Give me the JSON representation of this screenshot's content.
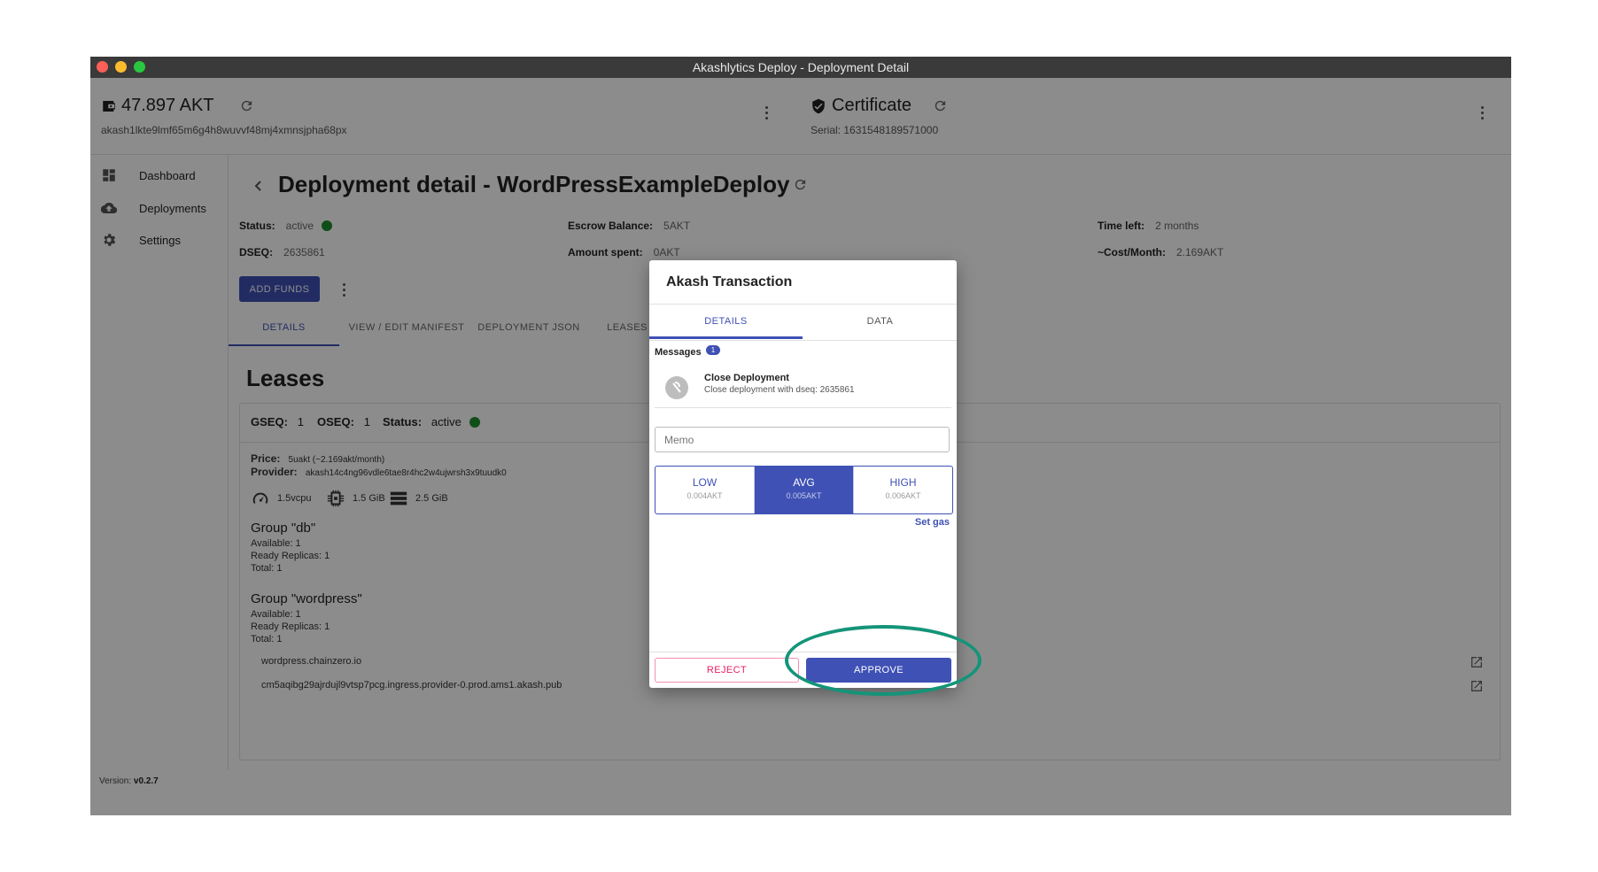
{
  "window": {
    "title": "Akashlytics Deploy - Deployment Detail"
  },
  "wallet": {
    "balance": "47.897 AKT",
    "address": "akash1lkte9lmf65m6g4h8wuvvf48mj4xmnsjpha68px"
  },
  "certificate": {
    "label": "Certificate",
    "serial": "Serial: 1631548189571000"
  },
  "sidebar": {
    "items": [
      {
        "label": "Dashboard"
      },
      {
        "label": "Deployments"
      },
      {
        "label": "Settings"
      }
    ]
  },
  "version": {
    "label": "Version:",
    "value": "v0.2.7"
  },
  "deployment": {
    "title": "Deployment detail - WordPressExampleDeploy",
    "status_label": "Status:",
    "status_value": "active",
    "dseq_label": "DSEQ:",
    "dseq_value": "2635861",
    "escrow_label": "Escrow Balance:",
    "escrow_value": "5AKT",
    "spent_label": "Amount spent:",
    "spent_value": "0AKT",
    "time_label": "Time left:",
    "time_value": "2 months",
    "cost_label": "~Cost/Month:",
    "cost_value": "2.169AKT",
    "add_funds": "ADD FUNDS"
  },
  "tabs": [
    "DETAILS",
    "VIEW / EDIT MANIFEST",
    "DEPLOYMENT JSON",
    "LEASES"
  ],
  "leases": {
    "title": "Leases",
    "gseq_label": "GSEQ:",
    "gseq_value": "1",
    "oseq_label": "OSEQ:",
    "oseq_value": "1",
    "status_label": "Status:",
    "status_value": "active",
    "price_label": "Price:",
    "price_value": "5uakt (~2.169akt/month)",
    "provider_label": "Provider:",
    "provider_value": "akash14c4ng96vdle6tae8r4hc2w4ujwrsh3x9tuudk0",
    "cpu": "1.5vcpu",
    "memory": "1.5 GiB",
    "storage": "2.5 GiB",
    "groups": [
      {
        "name": "Group \"db\"",
        "available": "Available: 1",
        "ready": "Ready Replicas: 1",
        "total": "Total: 1"
      },
      {
        "name": "Group \"wordpress\"",
        "available": "Available: 1",
        "ready": "Ready Replicas: 1",
        "total": "Total: 1"
      }
    ],
    "uris": [
      "wordpress.chainzero.io",
      "cm5aqibg29ajrdujl9vtsp7pcg.ingress.provider-0.prod.ams1.akash.pub"
    ]
  },
  "modal": {
    "title": "Akash Transaction",
    "tabs": [
      "DETAILS",
      "DATA"
    ],
    "messages_label": "Messages",
    "messages_count": "1",
    "message": {
      "title": "Close Deployment",
      "subtitle": "Close deployment with dseq: 2635861"
    },
    "memo_placeholder": "Memo",
    "fees": [
      {
        "label": "LOW",
        "amount": "0.004AKT"
      },
      {
        "label": "AVG",
        "amount": "0.005AKT"
      },
      {
        "label": "HIGH",
        "amount": "0.006AKT"
      }
    ],
    "set_gas": "Set gas",
    "reject": "REJECT",
    "approve": "APPROVE"
  },
  "colors": {
    "primary": "#3f51b5",
    "success": "#1e8e2e",
    "highlight": "#149479",
    "reject": "#e91e63"
  }
}
